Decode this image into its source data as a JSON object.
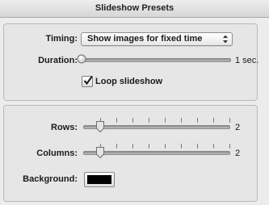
{
  "window": {
    "title": "Slideshow Presets"
  },
  "timing": {
    "label": "Timing:",
    "value": "Show images for fixed time"
  },
  "duration": {
    "label": "Duration:",
    "value_text": "1 sec."
  },
  "loop": {
    "label": "Loop slideshow",
    "checked": true
  },
  "rows": {
    "label": "Rows:",
    "value": 2,
    "value_text": "2"
  },
  "columns": {
    "label": "Columns:",
    "value": 2,
    "value_text": "2"
  },
  "background": {
    "label": "Background:",
    "color": "#000000"
  },
  "icons": {
    "popup": "up-down-arrows-icon",
    "check": "checkmark-icon"
  }
}
